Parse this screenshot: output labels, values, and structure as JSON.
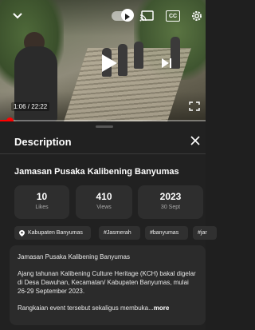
{
  "player": {
    "timecode": "1:06 / 22:22",
    "cc_label": "CC",
    "progress_fraction": 0.048,
    "colors": {
      "progress": "#ff0000"
    },
    "icons": [
      "chevron-down-icon",
      "autoplay-toggle",
      "cast-icon",
      "captions-icon",
      "settings-gear-icon",
      "play-icon",
      "next-icon",
      "fullscreen-icon"
    ]
  },
  "sheet": {
    "title": "Description",
    "video_title": "Jamasan Pusaka Kalibening Banyumas",
    "stats": [
      {
        "value": "10",
        "label": "Likes"
      },
      {
        "value": "410",
        "label": "Views"
      },
      {
        "value": "2023",
        "label": "30 Sept"
      }
    ],
    "chips": [
      {
        "label": "Kabupaten Banyumas",
        "icon": "location-pin-icon"
      },
      {
        "label": "#Jasmerah"
      },
      {
        "label": "#banyumas"
      },
      {
        "label": "#jar"
      }
    ],
    "description": {
      "line1": "Jamasan Pusaka Kalibening Banyumas",
      "para2": "Ajang tahunan Kalibening Culture Heritage (KCH) bakal digelar di Desa Dawuhan, Kecamatan/ Kabupaten Banyumas, mulai 26-29 September 2023.",
      "para3": "Rangkaian event tersebut sekaligus membuka...",
      "more": "more"
    }
  }
}
